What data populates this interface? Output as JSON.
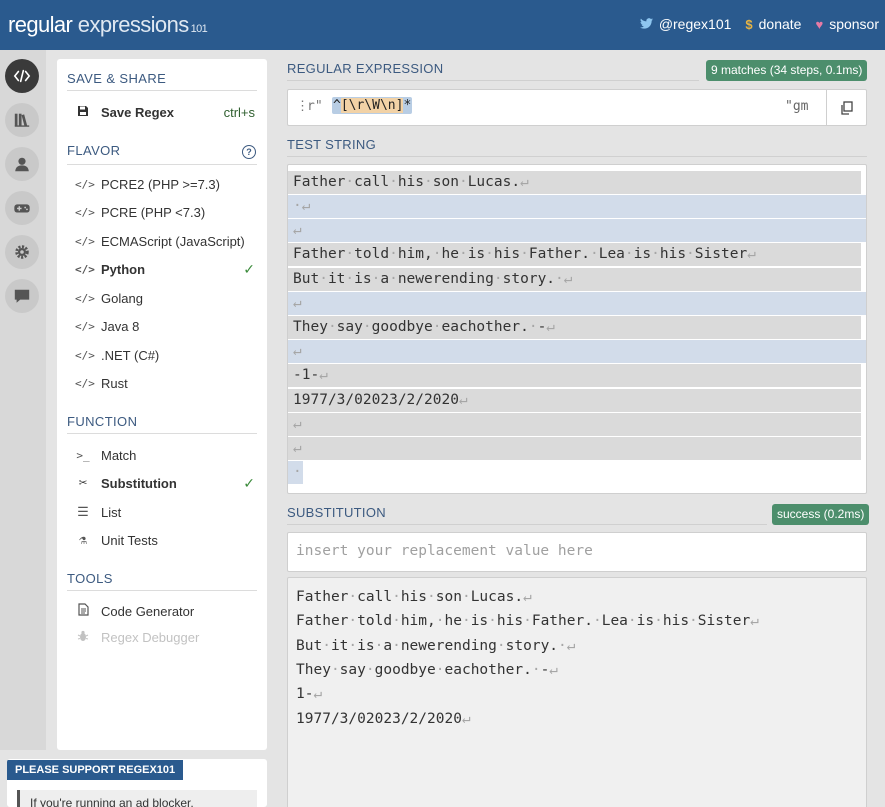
{
  "header": {
    "logo": {
      "part1": "regular",
      "part2": " expressions",
      "version": "101"
    },
    "links": [
      {
        "icon": "twitter-icon",
        "label": "@regex101"
      },
      {
        "icon": "dollar-icon",
        "label": "donate"
      },
      {
        "icon": "heart-icon",
        "label": "sponsor"
      }
    ]
  },
  "sidebar": {
    "buttons": [
      "regex-editor-icon",
      "library-icon",
      "account-icon",
      "quiz-icon",
      "settings-icon",
      "chat-icon"
    ]
  },
  "left_panel": {
    "save_share": {
      "title": "SAVE & SHARE",
      "save_label": "Save Regex",
      "save_shortcut": "ctrl+s"
    },
    "flavor": {
      "title": "FLAVOR",
      "items": [
        {
          "label": "PCRE2 (PHP >=7.3)",
          "selected": false
        },
        {
          "label": "PCRE (PHP <7.3)",
          "selected": false
        },
        {
          "label": "ECMAScript (JavaScript)",
          "selected": false
        },
        {
          "label": "Python",
          "selected": true
        },
        {
          "label": "Golang",
          "selected": false
        },
        {
          "label": "Java 8",
          "selected": false
        },
        {
          "label": ".NET (C#)",
          "selected": false
        },
        {
          "label": "Rust",
          "selected": false
        }
      ]
    },
    "function": {
      "title": "FUNCTION",
      "items": [
        {
          "label": "Match",
          "icon": ">_",
          "selected": false
        },
        {
          "label": "Substitution",
          "icon": "✂",
          "selected": true
        },
        {
          "label": "List",
          "icon": "☰",
          "selected": false
        },
        {
          "label": "Unit Tests",
          "icon": "⚗",
          "selected": false
        }
      ]
    },
    "tools": {
      "title": "TOOLS",
      "items": [
        {
          "label": "Code Generator",
          "enabled": true
        },
        {
          "label": "Regex Debugger",
          "enabled": false
        }
      ]
    },
    "support": {
      "tag": "PLEASE SUPPORT REGEX101",
      "text": "If you're running an ad blocker,"
    }
  },
  "main": {
    "regex": {
      "title": "REGULAR EXPRESSION",
      "badge": "9 matches (34 steps, 0.1ms)",
      "prefix": "r\"",
      "anchor": "^",
      "char_class": "[\\r\\W\\n]",
      "quantifier": "*",
      "suffix": "\"",
      "flags": "gm"
    },
    "test_string": {
      "title": "TEST STRING",
      "lines": [
        "Father·call·his·son·Lucas.↵",
        "·↵",
        "↵",
        "Father·told·him,·he·is·his·Father.·Lea·is·his·Sister↵",
        "But·it·is·a·newerending·story.·↵",
        "↵",
        "They·say·goodbye·eachother.·-↵",
        "↵",
        "-1-↵",
        "1977/3/02023/2/2020↵",
        "↵",
        "↵",
        "·"
      ]
    },
    "substitution": {
      "title": "SUBSTITUTION",
      "badge": "success (0.2ms)",
      "placeholder": "insert your replacement value here",
      "result_lines": [
        "Father·call·his·son·Lucas.↵",
        "Father·told·him,·he·is·his·Father.·Lea·is·his·Sister↵",
        "But·it·is·a·newerending·story.·↵",
        "They·say·goodbye·eachother.·-↵",
        "1-↵",
        "1977/3/02023/2/2020↵"
      ]
    }
  }
}
